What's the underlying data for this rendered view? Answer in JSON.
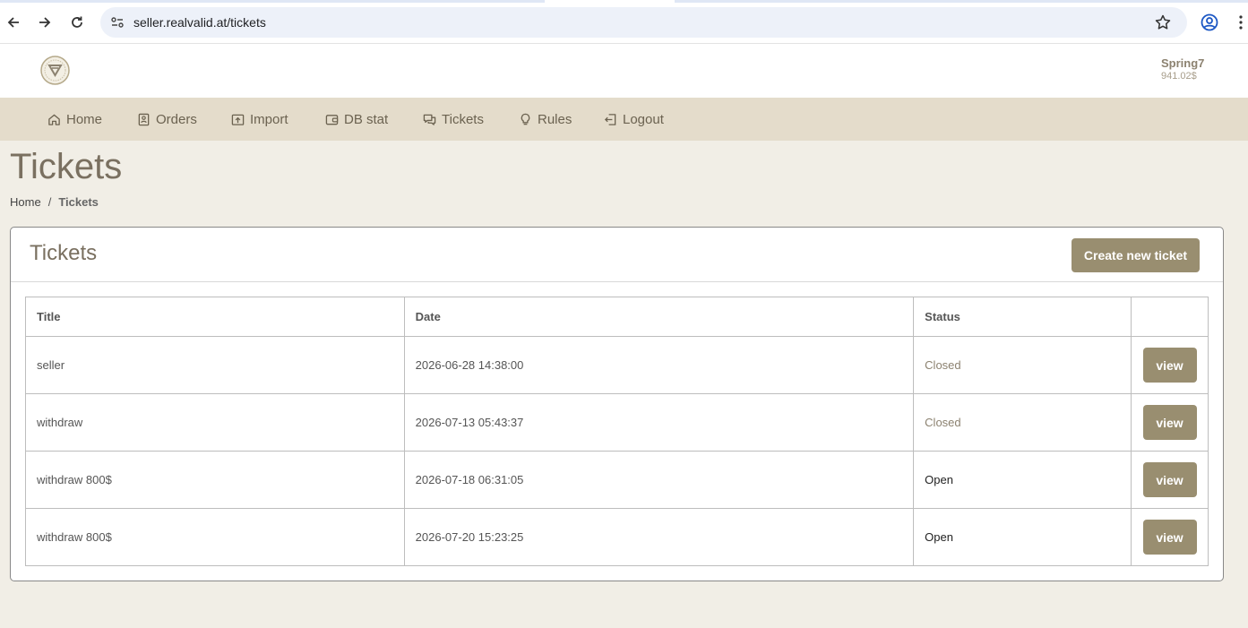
{
  "browser": {
    "url": "seller.realvalid.at/tickets"
  },
  "header": {
    "username": "Spring7",
    "balance": "941.02$"
  },
  "nav": {
    "items": [
      {
        "label": "Home",
        "icon": "home-icon"
      },
      {
        "label": "Orders",
        "icon": "orders-icon"
      },
      {
        "label": "Import",
        "icon": "import-icon"
      },
      {
        "label": "DB stat",
        "icon": "wallet-icon"
      },
      {
        "label": "Tickets",
        "icon": "chat-icon"
      },
      {
        "label": "Rules",
        "icon": "bulb-icon"
      },
      {
        "label": "Logout",
        "icon": "logout-icon"
      }
    ]
  },
  "page": {
    "title": "Tickets",
    "breadcrumb": {
      "home": "Home",
      "separator": "/",
      "current": "Tickets"
    }
  },
  "card": {
    "title": "Tickets",
    "create_label": "Create new ticket"
  },
  "table": {
    "headers": [
      "Title",
      "Date",
      "Status",
      ""
    ],
    "rows": [
      {
        "title": "seller",
        "date": "2026-06-28 14:38:00",
        "status": "Closed",
        "action": "view"
      },
      {
        "title": "withdraw",
        "date": "2026-07-13 05:43:37",
        "status": "Closed",
        "action": "view"
      },
      {
        "title": "withdraw 800$",
        "date": "2026-07-18 06:31:05",
        "status": "Open",
        "action": "view"
      },
      {
        "title": "withdraw 800$",
        "date": "2026-07-20 15:23:25",
        "status": "Open",
        "action": "view"
      }
    ]
  },
  "colors": {
    "accent": "#998e70",
    "navbar": "#e4dccb",
    "background": "#f1eee6",
    "heading": "#7a7060"
  }
}
